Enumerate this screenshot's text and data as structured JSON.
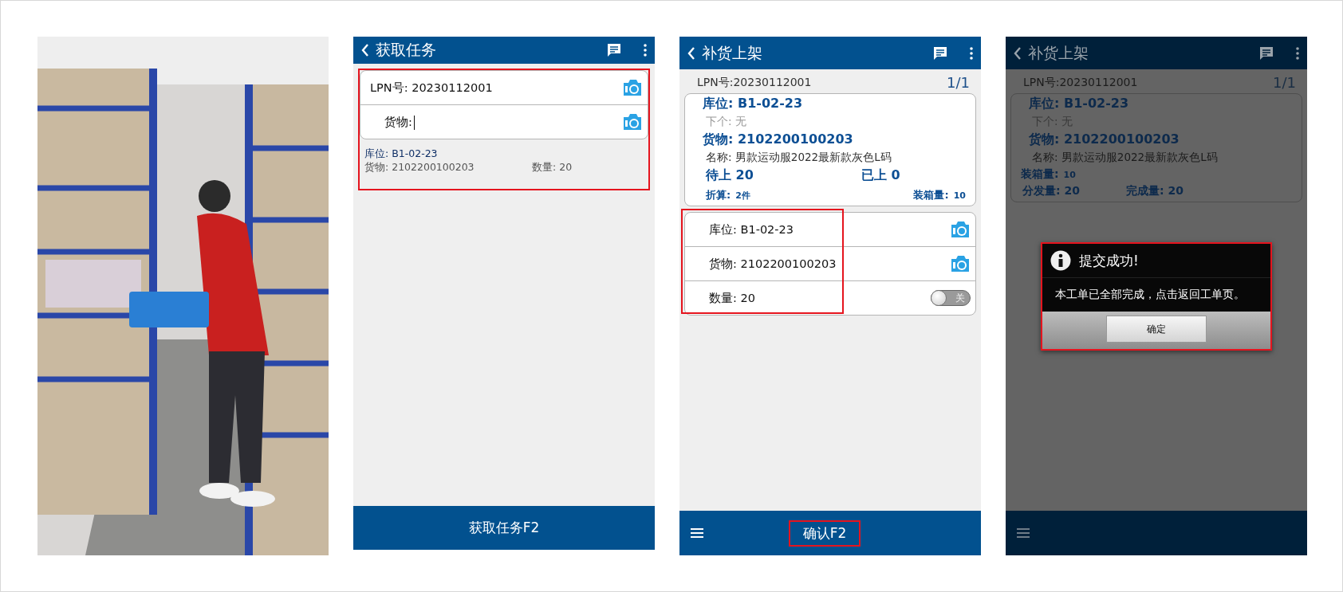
{
  "screen_1": {
    "title": "获取任务",
    "highlighted": true,
    "inputs": [
      {
        "label": "LPN号:",
        "value": "20230112001",
        "focused": false
      },
      {
        "label": "货物:",
        "focused": true
      }
    ],
    "task": {
      "location": "库位: B1-02-23",
      "goods": "货物: 2102200100203",
      "quantity": "数量: 20"
    },
    "bottom_button": "获取任务F2"
  },
  "screen_2": {
    "title": "补货上架",
    "lpn": "LPN号:20230112001",
    "page": "1/1",
    "card": {
      "location": "库位: B1-02-23",
      "next": "下个: 无",
      "goods": "货物: 2102200100203",
      "name": "名称: 男款运动服2022最新款灰色L码",
      "pending": "待上 20",
      "done": "已上 0",
      "convert_label": "折算:",
      "convert_value": "2件",
      "box_label": "装箱量:",
      "box_value": "10"
    },
    "inputs_highlighted": true,
    "inputs": [
      {
        "kind": "scan",
        "label": "库位: B1-02-23"
      },
      {
        "kind": "scan",
        "label": "货物: 2102200100203"
      },
      {
        "kind": "toggle",
        "label": "数量: 20",
        "on": false,
        "toggle_text": "关"
      }
    ],
    "confirm": {
      "label": "确认F2",
      "highlighted": true
    }
  },
  "screen_3": {
    "title": "补货上架",
    "dimmed": true,
    "lpn": "LPN号:20230112001",
    "page": "1/1",
    "card": {
      "location": "库位: B1-02-23",
      "next": "下个: 无",
      "goods": "货物: 2102200100203",
      "name": "名称: 男款运动服2022最新款灰色L码",
      "box_label": "装箱量:",
      "box_value": "10",
      "distributed": "分发量: 20",
      "completed": "完成量: 20"
    },
    "dialog": {
      "title": "提交成功!",
      "message": "本工单已全部完成，点击返回工单页。",
      "button": "确定",
      "highlighted": true
    }
  }
}
